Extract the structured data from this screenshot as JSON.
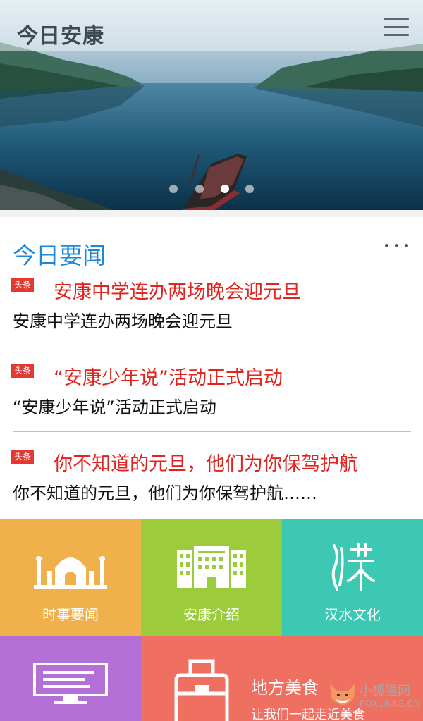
{
  "app": {
    "title": "今日安康"
  },
  "banner": {
    "slide_count": 4,
    "active_slide": 3
  },
  "news": {
    "section_title": "今日要闻",
    "items": [
      {
        "tag": "头条",
        "headline": "安康中学连办两场晚会迎元旦",
        "summary": "安康中学连办两场晚会迎元旦"
      },
      {
        "tag": "头条",
        "headline": "“安康少年说”活动正式启动",
        "summary": "“安康少年说”活动正式启动"
      },
      {
        "tag": "头条",
        "headline": "你不知道的元旦，他们为你保驾护航",
        "summary": "你不知道的元旦，他们为你保驾护航……"
      }
    ]
  },
  "tiles": {
    "current_news": {
      "label": "时事要闻",
      "color": "#f0b04b"
    },
    "about_ankang": {
      "label": "安康介绍",
      "color": "#9ccc3c"
    },
    "hanshui_culture": {
      "label": "汉水文化",
      "color": "#3cc8b2"
    },
    "screen_tile": {
      "color": "#b46fd6"
    },
    "local_food": {
      "title": "地方美食",
      "subtitle": "让我们一起走近美食",
      "color": "#ef6f61"
    }
  },
  "watermark": {
    "text": "小狐狸网",
    "subtext": "FOXLINKS.CN"
  }
}
